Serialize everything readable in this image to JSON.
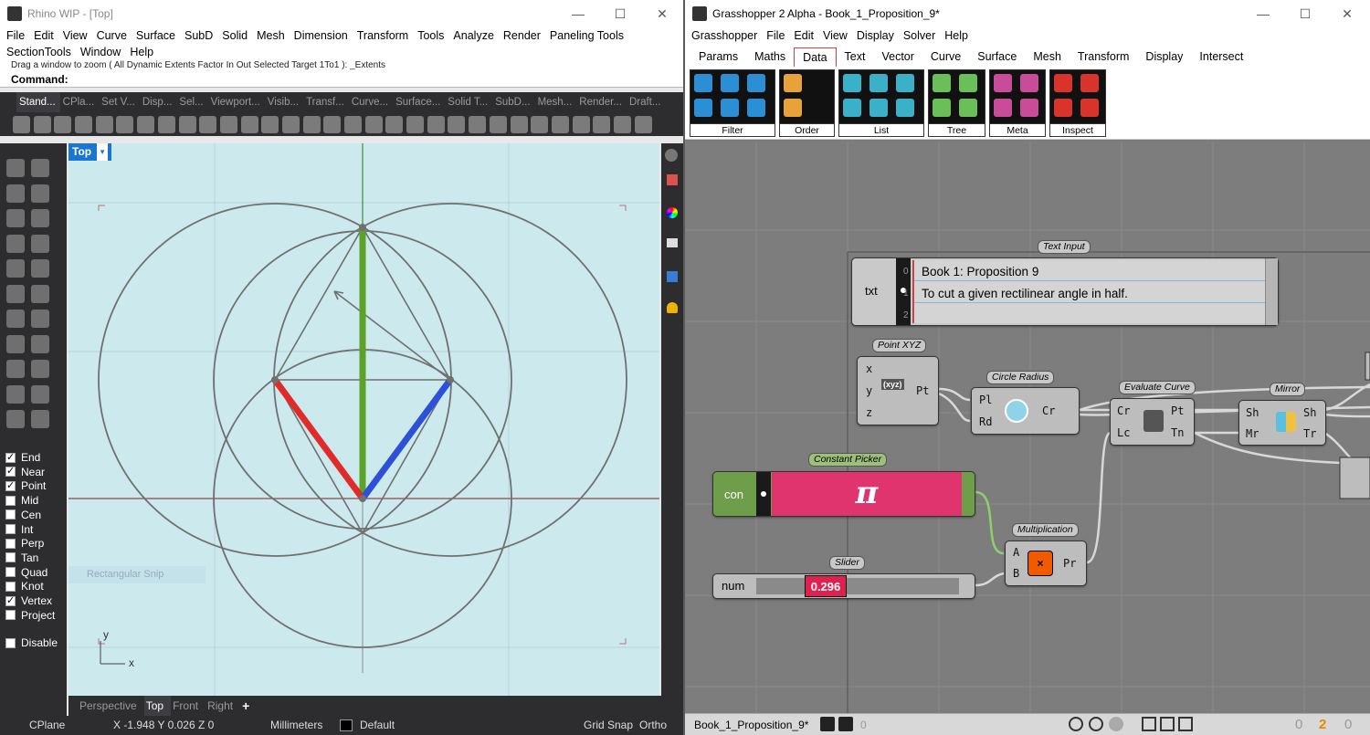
{
  "rhino": {
    "title": "Rhino WIP - [Top]",
    "menu": [
      "File",
      "Edit",
      "View",
      "Curve",
      "Surface",
      "SubD",
      "Solid",
      "Mesh",
      "Dimension",
      "Transform",
      "Tools",
      "Analyze",
      "Render",
      "Paneling Tools",
      "SectionTools",
      "Window",
      "Help"
    ],
    "command_history": "Drag a window to zoom ( All  Dynamic  Extents  Factor  In  Out  Selected  Target  1To1 ): _Extents",
    "command_label": "Command:",
    "toolbar_tabs": [
      "Stand...",
      "CPla...",
      "Set V...",
      "Disp...",
      "Sel...",
      "Viewport...",
      "Visib...",
      "Transf...",
      "Curve...",
      "Surface...",
      "Solid T...",
      "SubD...",
      "Mesh...",
      "Render...",
      "Draft..."
    ],
    "viewport_name": "Top",
    "axis_x": "x",
    "axis_y": "y",
    "snaps": [
      {
        "label": "End",
        "checked": true
      },
      {
        "label": "Near",
        "checked": true
      },
      {
        "label": "Point",
        "checked": true
      },
      {
        "label": "Mid",
        "checked": false
      },
      {
        "label": "Cen",
        "checked": false
      },
      {
        "label": "Int",
        "checked": false
      },
      {
        "label": "Perp",
        "checked": false
      },
      {
        "label": "Tan",
        "checked": false
      },
      {
        "label": "Quad",
        "checked": false
      },
      {
        "label": "Knot",
        "checked": false
      },
      {
        "label": "Vertex",
        "checked": true
      },
      {
        "label": "Project",
        "checked": false
      }
    ],
    "disable_label": "Disable",
    "snip_text": "Rectangular Snip",
    "viewport_tabs": [
      "Perspective",
      "Top",
      "Front",
      "Right"
    ],
    "add_tab": "+",
    "status": {
      "cplane": "CPlane",
      "coords": "X -1.948  Y 0.026  Z 0",
      "units": "Millimeters",
      "layer": "Default",
      "grid_snap": "Grid Snap",
      "ortho": "Ortho"
    },
    "colors": {
      "green": "#5aa228",
      "red": "#e02b2b",
      "blue": "#2e4fd8",
      "viewport_bg": "#cce9ee"
    }
  },
  "grasshopper": {
    "title": "Grasshopper 2 Alpha - Book_1_Proposition_9*",
    "menu": [
      "Grasshopper",
      "File",
      "Edit",
      "View",
      "Display",
      "Solver",
      "Help"
    ],
    "tabs": [
      "Params",
      "Maths",
      "Data",
      "Text",
      "Vector",
      "Curve",
      "Surface",
      "Mesh",
      "Transform",
      "Display",
      "Intersect"
    ],
    "active_tab": "Data",
    "ribbon_groups": [
      "Filter",
      "Order",
      "List",
      "Tree",
      "Meta",
      "Inspect"
    ],
    "components": {
      "text_input": {
        "label": "Text Input",
        "nick": "txt",
        "index": [
          "0",
          "1",
          "2"
        ],
        "lines": [
          "Book 1: Proposition 9",
          "To cut a given rectilinear angle in half."
        ]
      },
      "point_xyz": {
        "label": "Point XYZ",
        "inputs": [
          "x",
          "y",
          "z"
        ],
        "output": "Pt",
        "icon": "(xyz)"
      },
      "circle_radius": {
        "label": "Circle Radius",
        "inputs": [
          "Pl",
          "Rd"
        ],
        "output": "Cr"
      },
      "evaluate_curve": {
        "label": "Evaluate Curve",
        "inputs": [
          "Cr",
          "Lc"
        ],
        "outputs": [
          "Pt",
          "Tn"
        ]
      },
      "mirror": {
        "label": "Mirror",
        "inputs": [
          "Sh",
          "Mr"
        ],
        "outputs": [
          "Sh",
          "Tr"
        ]
      },
      "constant_picker": {
        "label": "Constant Picker",
        "nick": "con",
        "symbol": "π"
      },
      "multiplication": {
        "label": "Multiplication",
        "inputs": [
          "A",
          "B"
        ],
        "output": "Pr"
      },
      "slider": {
        "label": "Slider",
        "nick": "num",
        "value": "0.296"
      }
    },
    "status": {
      "file": "Book_1_Proposition_9*",
      "zero": "0",
      "count_a": "0",
      "count_b": "2",
      "count_c": "0"
    }
  }
}
